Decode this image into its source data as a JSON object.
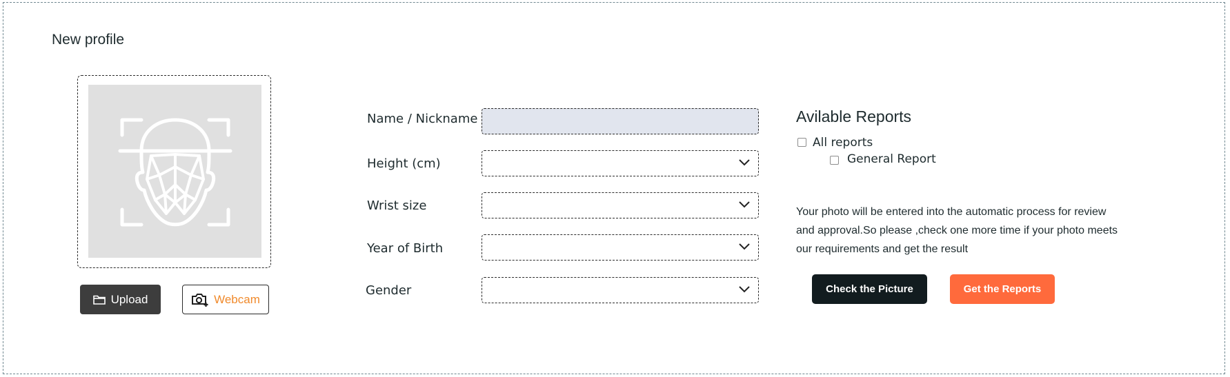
{
  "form": {
    "title": "New profile",
    "photo": {
      "upload_label": "Upload",
      "webcam_label": "Webcam",
      "placeholder_icon": "face-scan-icon"
    },
    "fields": {
      "name_label": "Name / Nickname",
      "name_value": "",
      "height_label": "Height (cm)",
      "height_value": "",
      "wrist_label": "Wrist size",
      "wrist_value": "",
      "year_label": "Year of Birth",
      "year_value": "",
      "gender_label": "Gender",
      "gender_value": ""
    },
    "reports": {
      "title": "Avilable Reports",
      "all_label": "All reports",
      "all_checked": false,
      "general_label": "General Report",
      "general_checked": false
    },
    "note": "Your photo will be entered into the automatic process for review and approval.So please ,check one more time if your photo meets our requirements and get the result",
    "check_button": "Check the Picture",
    "reports_button": "Get the Reports"
  },
  "colors": {
    "upload_bg": "#3d3d3d",
    "webcam_text": "#f08a2c",
    "check_bg": "#121c1f",
    "reports_bg": "#ff6a3c",
    "input_bg": "#e1e5ee"
  }
}
